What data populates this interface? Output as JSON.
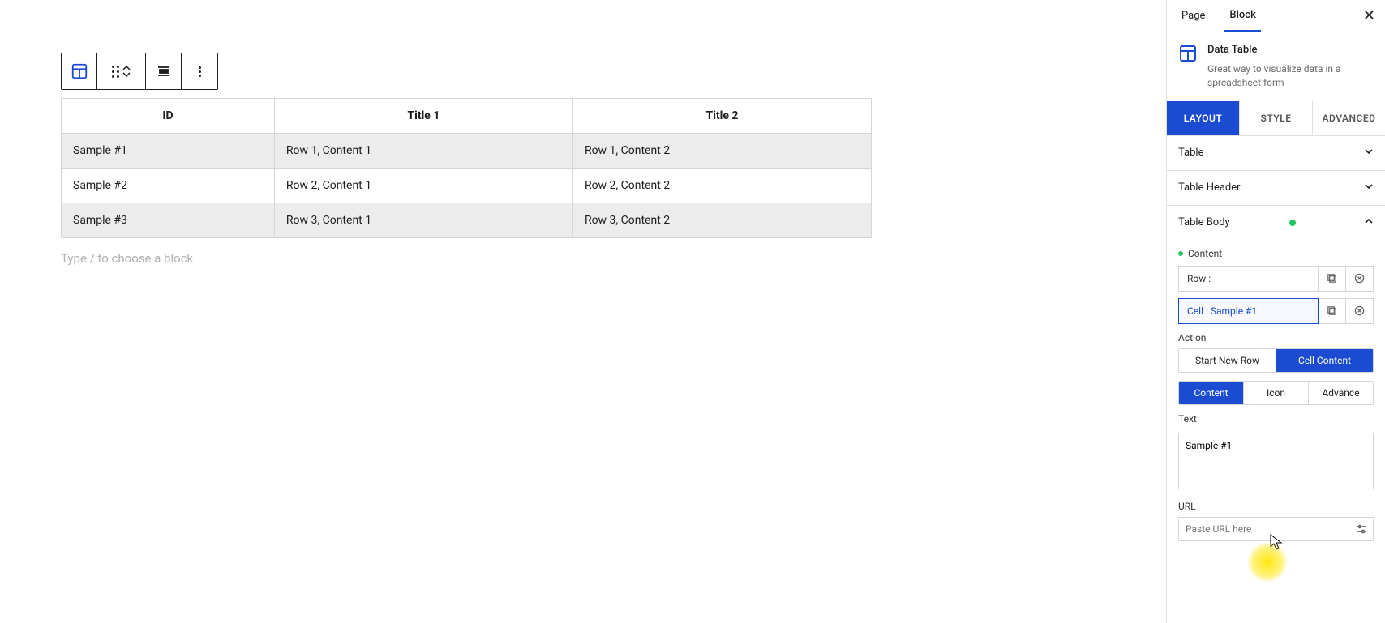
{
  "table": {
    "headers": [
      "ID",
      "Title 1",
      "Title 2"
    ],
    "rows": [
      [
        "Sample #1",
        "Row 1, Content 1",
        "Row 1, Content 2"
      ],
      [
        "Sample #2",
        "Row 2, Content 1",
        "Row 2, Content 2"
      ],
      [
        "Sample #3",
        "Row 3, Content 1",
        "Row 3, Content 2"
      ]
    ]
  },
  "editor": {
    "placeholder": "Type / to choose a block"
  },
  "sidebar": {
    "tabs": {
      "page": "Page",
      "block": "Block"
    },
    "block_info": {
      "title": "Data Table",
      "desc": "Great way to visualize data in a spreadsheet form"
    },
    "inspector_tabs": {
      "layout": "LAYOUT",
      "style": "STYLE",
      "advanced": "ADVANCED"
    },
    "panels": {
      "table": "Table",
      "table_header": "Table Header",
      "table_body": "Table Body"
    },
    "body": {
      "content_label": "Content",
      "row_label": "Row :",
      "cell_label": "Cell : Sample #1",
      "action_label": "Action",
      "action_options": {
        "start_new_row": "Start New Row",
        "cell_content": "Cell Content"
      },
      "section_tabs": {
        "content": "Content",
        "icon": "Icon",
        "advance": "Advance"
      },
      "text_label": "Text",
      "text_value": "Sample #1",
      "url_label": "URL",
      "url_placeholder": "Paste URL here"
    }
  }
}
